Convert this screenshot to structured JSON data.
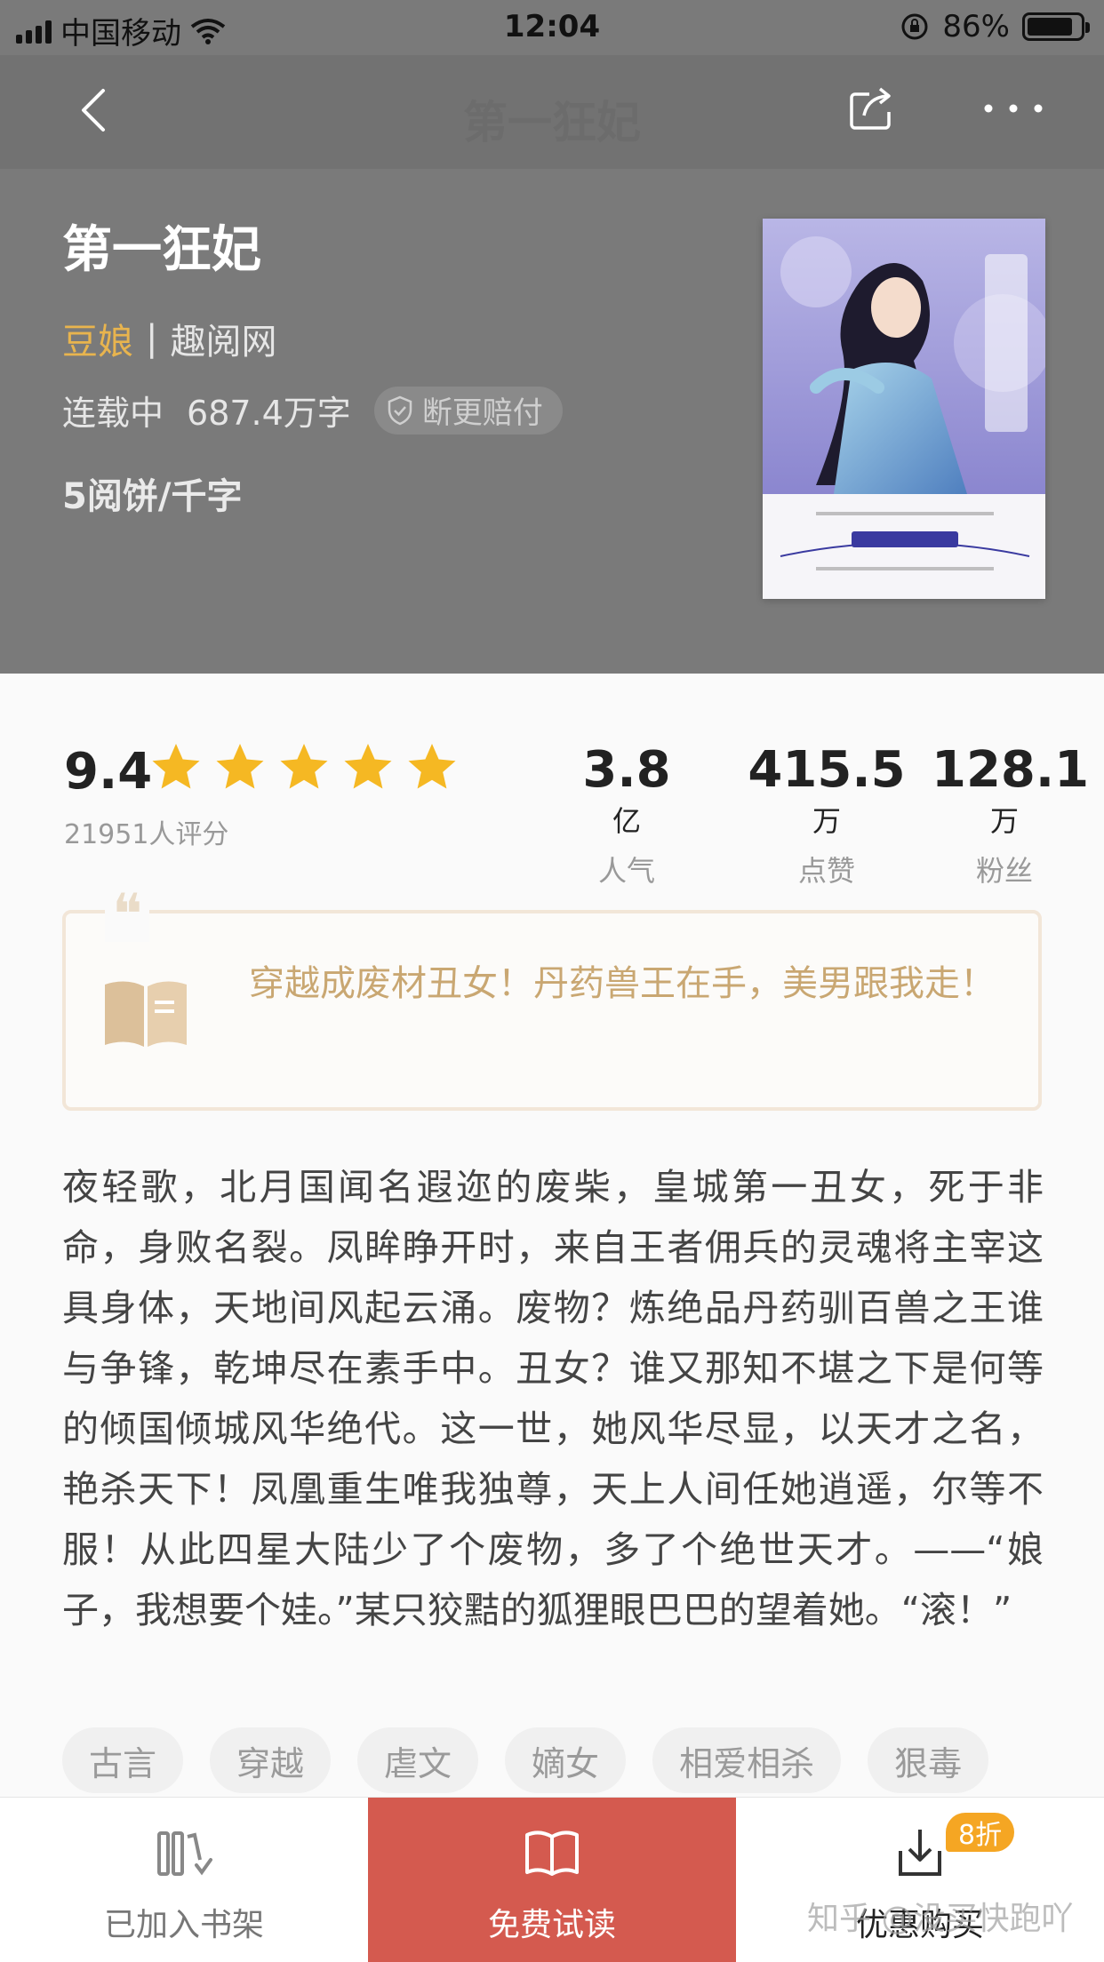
{
  "status_bar": {
    "carrier": "中国移动",
    "time": "12:04",
    "battery": "86%"
  },
  "nav": {
    "title": "第一狂妃"
  },
  "book": {
    "title": "第一狂妃",
    "author": "豆娘",
    "separator": "|",
    "source": "趣阅网",
    "status": "连载中",
    "word_count": "687.4万字",
    "guarantee": "断更赔付",
    "price": "5阅饼/千字"
  },
  "rating": {
    "score": "9.4",
    "stars": 5,
    "count": "21951人评分"
  },
  "stats": [
    {
      "num": "3.8",
      "unit": "亿",
      "label": "人气"
    },
    {
      "num": "415.5",
      "unit": "万",
      "label": "点赞"
    },
    {
      "num": "128.1",
      "unit": "万",
      "label": "粉丝"
    }
  ],
  "quote": {
    "mark": "❝",
    "text": "穿越成废材丑女！丹药兽王在手，美男跟我走！"
  },
  "description": "夜轻歌，北月国闻名遐迩的废柴，皇城第一丑女，死于非命，身败名裂。凤眸睁开时，来自王者佣兵的灵魂将主宰这具身体，天地间风起云涌。废物？炼绝品丹药驯百兽之王谁与争锋，乾坤尽在素手中。丑女？谁又那知不堪之下是何等的倾国倾城风华绝代。这一世，她风华尽显，以天才之名，艳杀天下！凤凰重生唯我独尊，天上人间任她逍遥，尔等不服！从此四星大陆少了个废物，多了个绝世天才。——“娘子，我想要个娃。”某只狡黠的狐狸眼巴巴的望着她。“滚！”",
  "tags": [
    "古言",
    "穿越",
    "虐文",
    "嫡女",
    "相爱相杀",
    "狠毒"
  ],
  "bottom_bar": {
    "shelf_label": "已加入书架",
    "trial_label": "免费试读",
    "buy_label": "优惠购买",
    "discount": "8折"
  },
  "watermark": "知乎 @没买快跑吖",
  "colors": {
    "accent": "#d45a4f",
    "author": "#e8b44e",
    "star": "#f5b823",
    "quote": "#c9a772"
  }
}
